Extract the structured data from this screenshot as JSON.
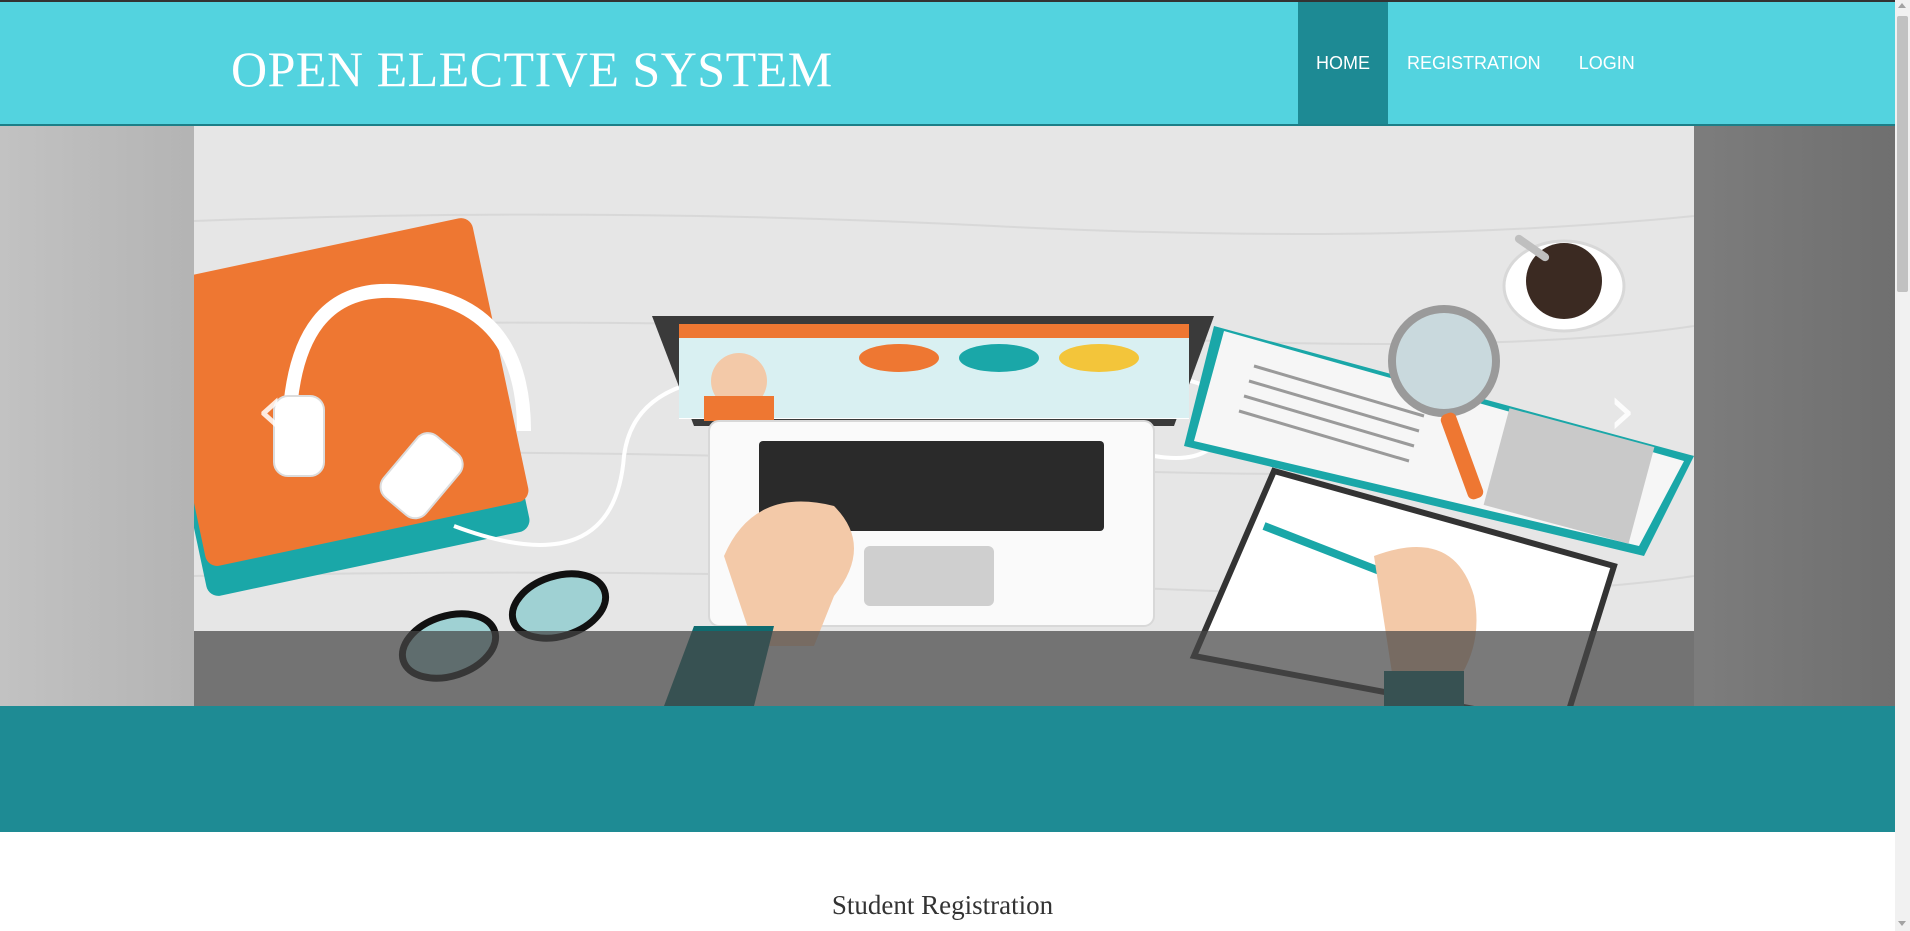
{
  "header": {
    "title": "OPEN ELECTIVE SYSTEM",
    "nav": [
      {
        "label": "HOME",
        "active": true
      },
      {
        "label": "REGISTRATION",
        "active": false
      },
      {
        "label": "LOGIN",
        "active": false
      }
    ]
  },
  "carousel": {
    "image_description": "Flat illustration of a desk with laptop showing graduate, headphones on books, glasses, coffee cup, magnifier on open book and a hand writing",
    "prev_icon": "chevron-left-icon",
    "next_icon": "chevron-right-icon",
    "prev_glyph": "‹",
    "next_glyph": "›"
  },
  "main": {
    "section_title": "Student Registration"
  },
  "colors": {
    "header_bg": "#53d3df",
    "nav_active_bg": "#1d8a94",
    "band_bg": "#1e8b94"
  }
}
